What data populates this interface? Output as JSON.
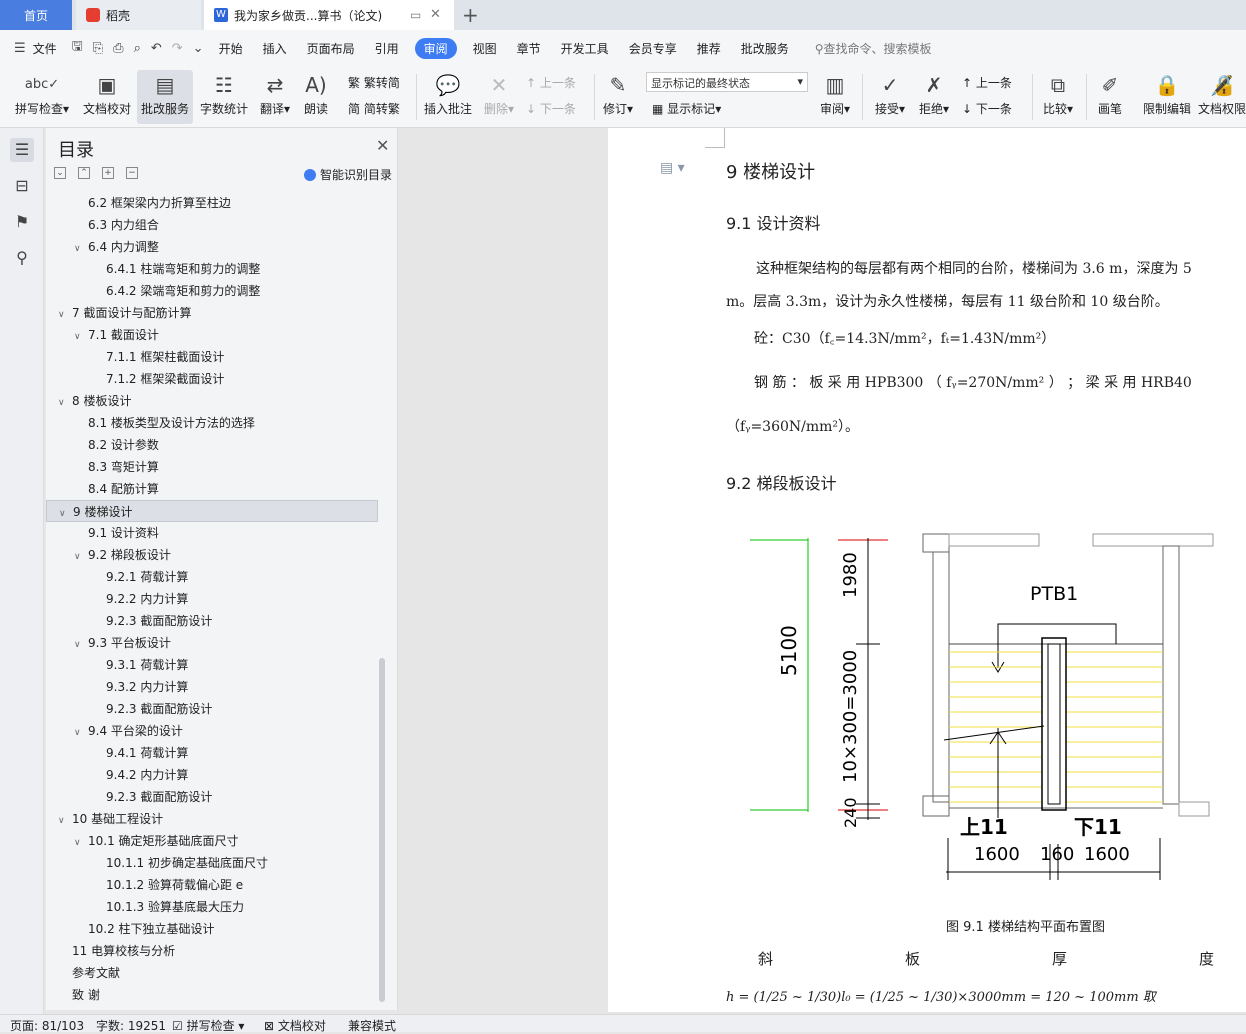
{
  "tabs": {
    "home": "首页",
    "daoke": "稻壳",
    "doc": "我为家乡做贡...算书（论文)"
  },
  "menu": {
    "file": "文件",
    "items": [
      "开始",
      "插入",
      "页面布局",
      "引用",
      "审阅",
      "视图",
      "章节",
      "开发工具",
      "会员专享",
      "推荐",
      "批改服务"
    ],
    "search": "查找命令、搜索模板"
  },
  "ribbon": {
    "spell": "拼写检查",
    "proof": "文档校对",
    "correct": "批改服务",
    "wordcount": "字数统计",
    "translate": "翻译",
    "read": "朗读",
    "trad": "繁转简",
    "simp": "简转繁",
    "insert_comment": "插入批注",
    "delete": "删除",
    "prev": "上一条",
    "next": "下一条",
    "track": "修订",
    "markup_state": "显示标记的最终状态",
    "show_markup": "显示标记",
    "review": "审阅",
    "accept": "接受",
    "reject": "拒绝",
    "prev2": "上一条",
    "next2": "下一条",
    "compare": "比较",
    "pen": "画笔",
    "restrict": "限制编辑",
    "doc_perm": "文档权限"
  },
  "toc": {
    "title": "目录",
    "smart": "智能识别目录",
    "items": [
      {
        "text": "6.2 框架梁内力折算至柱边",
        "level": 2
      },
      {
        "text": "6.3 内力组合",
        "level": 2
      },
      {
        "text": "6.4 内力调整",
        "level": 2,
        "open": true
      },
      {
        "text": "6.4.1 柱端弯矩和剪力的调整",
        "level": 3
      },
      {
        "text": "6.4.2 梁端弯矩和剪力的调整",
        "level": 3
      },
      {
        "text": "7  截面设计与配筋计算",
        "level": 1,
        "open": true
      },
      {
        "text": "7.1 截面设计",
        "level": 2,
        "open": true
      },
      {
        "text": "7.1.1 框架柱截面设计",
        "level": 3
      },
      {
        "text": "7.1.2 框架梁截面设计",
        "level": 3
      },
      {
        "text": "8  楼板设计",
        "level": 1,
        "open": true
      },
      {
        "text": "8.1 楼板类型及设计方法的选择",
        "level": 2
      },
      {
        "text": "8.2 设计参数",
        "level": 2
      },
      {
        "text": "8.3 弯矩计算",
        "level": 2
      },
      {
        "text": "8.4 配筋计算",
        "level": 2
      },
      {
        "text": "9  楼梯设计",
        "level": 1,
        "open": true,
        "selected": true
      },
      {
        "text": "9.1 设计资料",
        "level": 2
      },
      {
        "text": "9.2 梯段板设计",
        "level": 2,
        "open": true
      },
      {
        "text": "9.2.1 荷载计算",
        "level": 3
      },
      {
        "text": "9.2.2 内力计算",
        "level": 3
      },
      {
        "text": "9.2.3 截面配筋设计",
        "level": 3
      },
      {
        "text": "9.3 平台板设计",
        "level": 2,
        "open": true
      },
      {
        "text": "9.3.1 荷载计算",
        "level": 3
      },
      {
        "text": "9.3.2 内力计算",
        "level": 3
      },
      {
        "text": "9.2.3 截面配筋设计",
        "level": 3
      },
      {
        "text": "9.4 平台梁的设计",
        "level": 2,
        "open": true
      },
      {
        "text": "9.4.1 荷载计算",
        "level": 3
      },
      {
        "text": "9.4.2 内力计算",
        "level": 3
      },
      {
        "text": "9.2.3 截面配筋设计",
        "level": 3
      },
      {
        "text": "10  基础工程设计",
        "level": 1,
        "open": true
      },
      {
        "text": "10.1 确定矩形基础底面尺寸",
        "level": 2,
        "open": true
      },
      {
        "text": "10.1.1 初步确定基础底面尺寸",
        "level": 3
      },
      {
        "text": "10.1.2 验算荷载偏心距 e",
        "level": 3
      },
      {
        "text": "10.1.3 验算基底最大压力",
        "level": 3
      },
      {
        "text": "10.2 柱下独立基础设计",
        "level": 2
      },
      {
        "text": "11  电算校核与分析",
        "level": 1
      },
      {
        "text": "参考文献",
        "level": 1
      },
      {
        "text": "致    谢",
        "level": 1
      }
    ]
  },
  "doc": {
    "h1": "9  楼梯设计",
    "h2a": "9.1 设计资料",
    "p1": "这种框架结构的每层都有两个相同的台阶，楼梯间为 3.6 m，深度为 5",
    "p2": "m。层高 3.3m，设计为永久性楼梯，每层有 11 级台阶和 10 级台阶。",
    "p3": "砼：C30（f꜀=14.3N/mm²，fₜ=1.43N/mm²）",
    "p4": "钢 筋 ： 板 采 用  HPB300  （ fᵧ=270N/mm² ） ； 梁 采 用  HRB40",
    "p5": "（fᵧ=360N/mm²）。",
    "h2b": "9.2 梯段板设计",
    "drawing": {
      "ptb": "PTB1",
      "d5100": "5100",
      "d1980": "1980",
      "d3000": "10×300=3000",
      "d240": "240",
      "up": "上11",
      "down": "下11",
      "w1": "1600",
      "w2": "160",
      "w3": "1600"
    },
    "caption": "图 9.1  楼梯结构平面布置图",
    "justify": [
      "斜",
      "板",
      "厚",
      "度"
    ],
    "formula": "h = (1/25 ~ 1/30)l₀ = (1/25 ~ 1/30)×3000mm = 120 ~ 100mm     取"
  },
  "status": {
    "page": "页面: 81/103",
    "words": "字数: 19251",
    "spell": "拼写检查",
    "proof": "文档校对",
    "compat": "兼容模式"
  }
}
